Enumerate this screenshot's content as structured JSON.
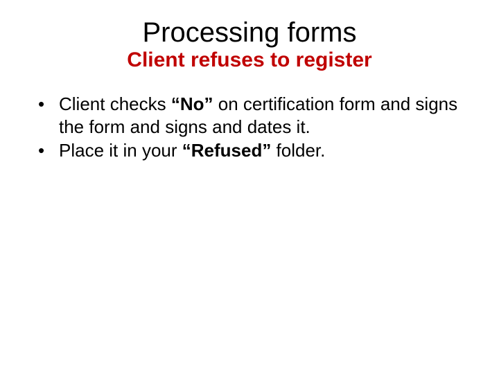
{
  "title": "Processing forms",
  "subtitle": "Client refuses to register",
  "bullets": [
    {
      "pre": "Client checks ",
      "bold": "“No”",
      "post": " on certification form and signs the form and signs and dates it."
    },
    {
      "pre": "Place it in your ",
      "bold": "“Refused”",
      "post": " folder."
    }
  ]
}
